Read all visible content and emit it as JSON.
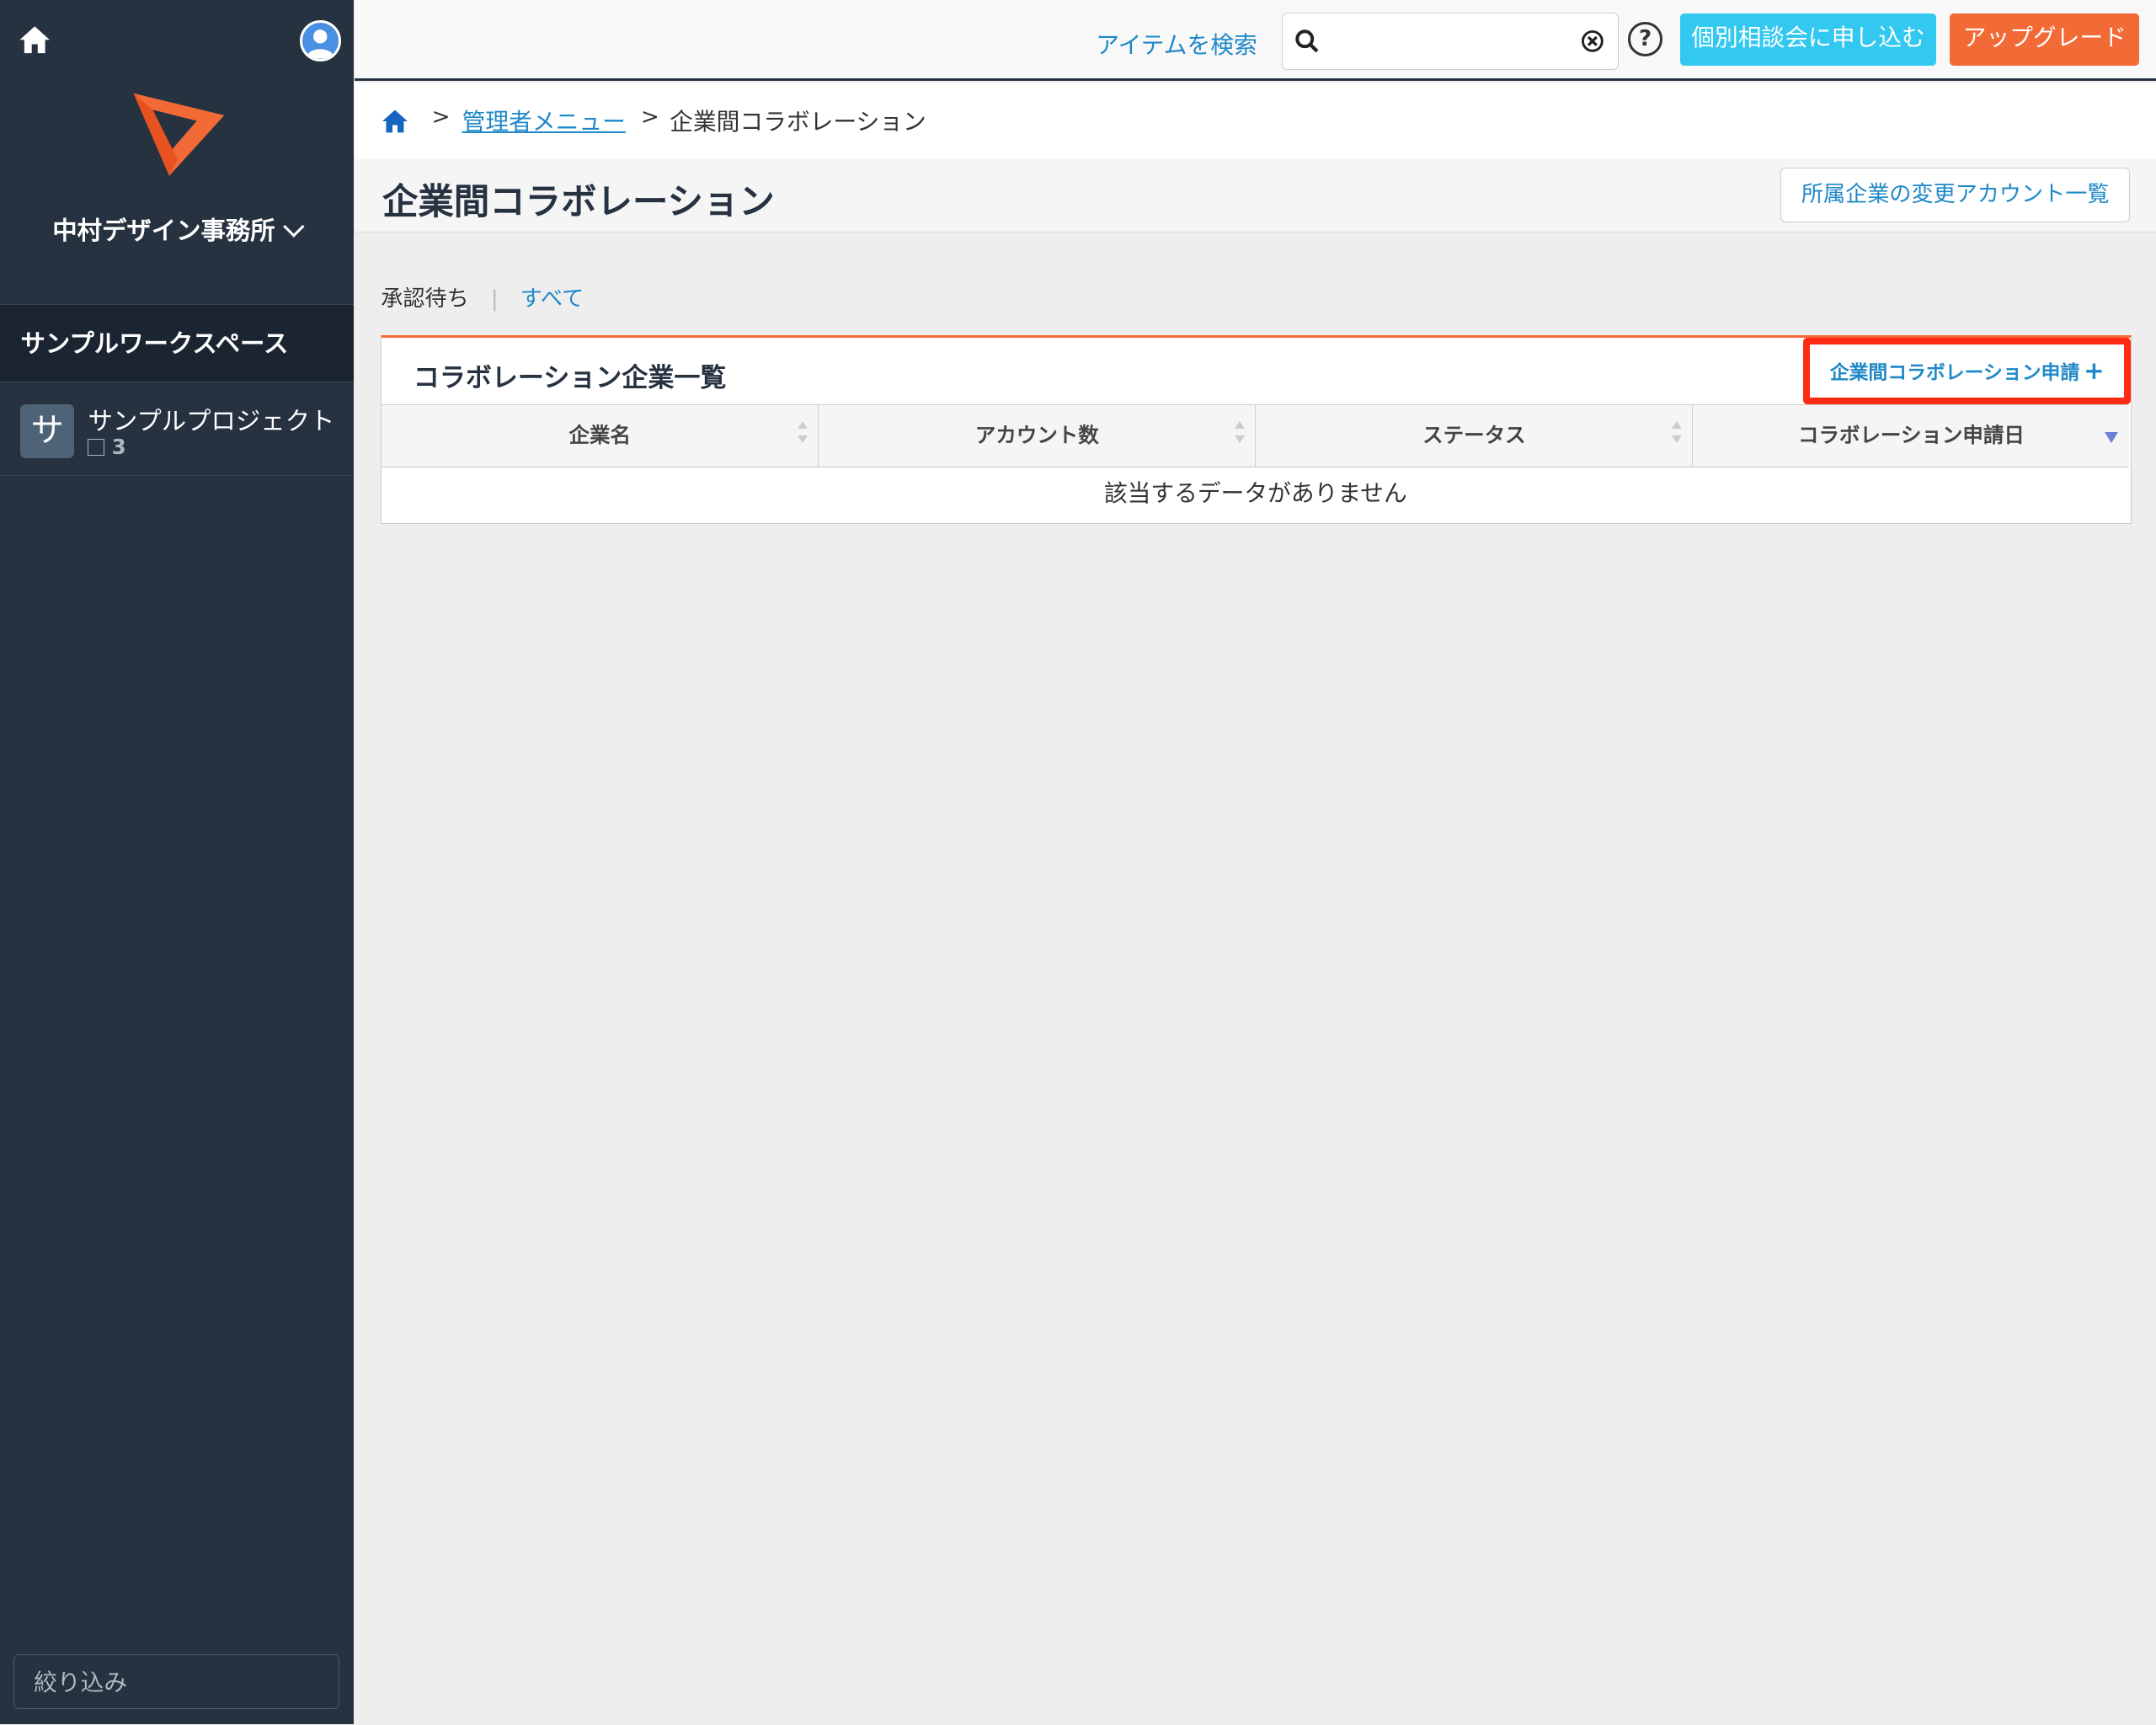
{
  "sidebar": {
    "org_name": "中村デザイン事務所",
    "workspace_name": "サンプルワークスペース",
    "project": {
      "initial": "サ",
      "name": "サンプルプロジェクト",
      "task_count": "3"
    },
    "filter_placeholder": "絞り込み"
  },
  "topbar": {
    "search_link": "アイテムを検索",
    "search_value": "",
    "help_label": "?",
    "consult_button": "個別相談会に申し込む",
    "upgrade_button": "アップグレード"
  },
  "breadcrumb": {
    "separator": ">",
    "admin_menu": "管理者メニュー",
    "current": "企業間コラボレーション"
  },
  "page": {
    "title": "企業間コラボレーション",
    "changed_accounts_button": "所属企業の変更アカウント一覧"
  },
  "tabs": {
    "pending": "承認待ち",
    "divider": "|",
    "all": "すべて"
  },
  "card": {
    "title": "コラボレーション企業一覧",
    "apply_button": "企業間コラボレーション申請",
    "apply_plus": "+",
    "columns": [
      "企業名",
      "アカウント数",
      "ステータス",
      "コラボレーション申請日"
    ],
    "empty_message": "該当するデータがありません"
  },
  "colors": {
    "accent_orange": "#f26a35",
    "accent_cyan": "#33c8f0",
    "link_blue": "#1e88c8",
    "sidebar": "#263240",
    "highlight_red": "#ff2a12"
  }
}
